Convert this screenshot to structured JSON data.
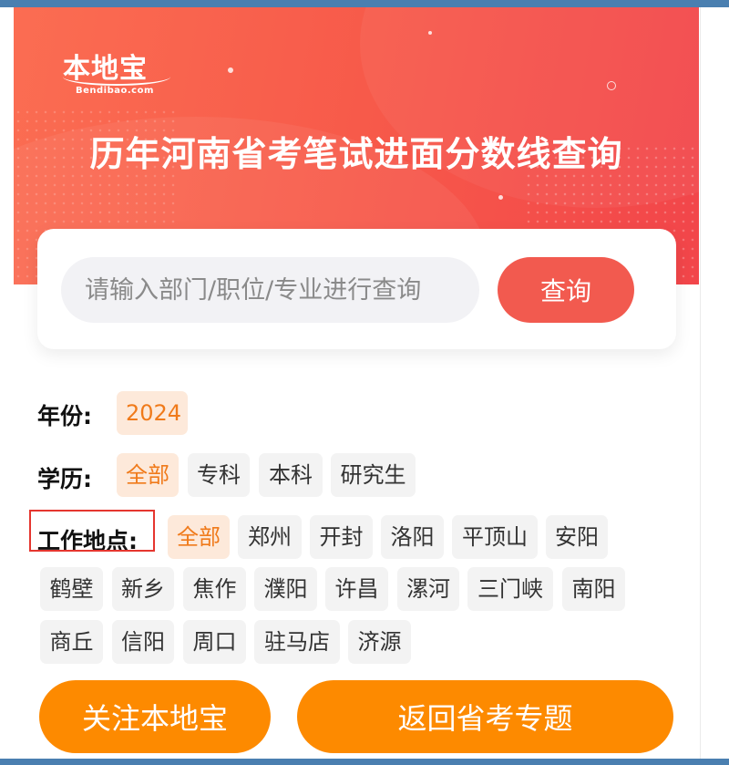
{
  "header": {
    "logo_text": "本地宝",
    "logo_sub": "Bendibao.com",
    "title": "历年河南省考笔试进面分数线查询"
  },
  "search": {
    "placeholder": "请输入部门/职位/专业进行查询",
    "value": "",
    "button_label": "查询"
  },
  "filters": {
    "year": {
      "label": "年份:",
      "options": [
        {
          "label": "2024",
          "active": true
        }
      ]
    },
    "education": {
      "label": "学历:",
      "options": [
        {
          "label": "全部",
          "active": true
        },
        {
          "label": "专科",
          "active": false
        },
        {
          "label": "本科",
          "active": false
        },
        {
          "label": "研究生",
          "active": false
        }
      ]
    },
    "location": {
      "label": "工作地点:",
      "options": [
        {
          "label": "全部",
          "active": true
        },
        {
          "label": "郑州",
          "active": false
        },
        {
          "label": "开封",
          "active": false
        },
        {
          "label": "洛阳",
          "active": false
        },
        {
          "label": "平顶山",
          "active": false
        },
        {
          "label": "安阳",
          "active": false
        },
        {
          "label": "鹤壁",
          "active": false
        },
        {
          "label": "新乡",
          "active": false
        },
        {
          "label": "焦作",
          "active": false
        },
        {
          "label": "濮阳",
          "active": false
        },
        {
          "label": "许昌",
          "active": false
        },
        {
          "label": "漯河",
          "active": false
        },
        {
          "label": "三门峡",
          "active": false
        },
        {
          "label": "南阳",
          "active": false
        },
        {
          "label": "商丘",
          "active": false
        },
        {
          "label": "信阳",
          "active": false
        },
        {
          "label": "周口",
          "active": false
        },
        {
          "label": "驻马店",
          "active": false
        },
        {
          "label": "济源",
          "active": false
        }
      ]
    }
  },
  "actions": {
    "follow_label": "关注本地宝",
    "back_label": "返回省考专题"
  },
  "colors": {
    "accent": "#f25a4f",
    "chip_active_bg": "#fde9da",
    "chip_active_text": "#f07a1a",
    "action_orange": "#fd8a00",
    "highlight_red": "#e5362f"
  }
}
